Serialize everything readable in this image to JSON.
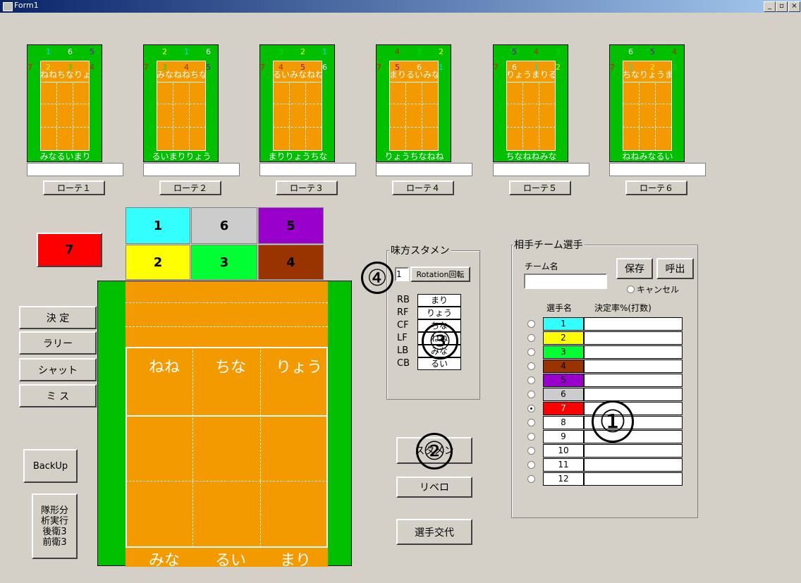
{
  "window": {
    "title": "Form1",
    "min": "_",
    "restore": "▫",
    "close": "×"
  },
  "mini_courts": [
    {
      "top_nums": [
        "1",
        "6",
        "5"
      ],
      "top_colors": [
        "#00e0e0",
        "#ffffff",
        "#8000c0"
      ],
      "left_num": "7",
      "row_nums": [
        "2",
        "3",
        "4"
      ],
      "row_colors": [
        "#ffff00",
        "#00e000",
        "#a03000"
      ],
      "names": "ねねちなりょう",
      "bottom": "みなるいまり",
      "button": "ローテ１"
    },
    {
      "top_nums": [
        "2",
        "1",
        "6"
      ],
      "top_colors": [
        "#ffff00",
        "#00e0e0",
        "#ffffff"
      ],
      "left_num": "7",
      "row_nums": [
        "3",
        "4",
        "5"
      ],
      "row_colors": [
        "#00e000",
        "#a03000",
        "#8000c0"
      ],
      "names": "みなねねちな",
      "bottom": "るいまりりょう",
      "button": "ローテ２"
    },
    {
      "top_nums": [
        "3",
        "2",
        "1"
      ],
      "top_colors": [
        "#00e000",
        "#ffff00",
        "#00e0e0"
      ],
      "left_num": "7",
      "row_nums": [
        "4",
        "5",
        "6"
      ],
      "row_colors": [
        "#a03000",
        "#8000c0",
        "#ffffff"
      ],
      "names": "るいみなねね",
      "bottom": "まりりょうちな",
      "button": "ローテ３"
    },
    {
      "top_nums": [
        "4",
        "3",
        "2"
      ],
      "top_colors": [
        "#a03000",
        "#00e000",
        "#ffff00"
      ],
      "left_num": "7",
      "row_nums": [
        "5",
        "6",
        "1"
      ],
      "row_colors": [
        "#8000c0",
        "#ffffff",
        "#00e0e0"
      ],
      "names": "まりるいみな",
      "bottom": "りょうちなねね",
      "button": "ローテ４"
    },
    {
      "top_nums": [
        "5",
        "4",
        "3"
      ],
      "top_colors": [
        "#8000c0",
        "#a03000",
        "#00e000"
      ],
      "left_num": "7",
      "row_nums": [
        "6",
        "1",
        "2"
      ],
      "row_colors": [
        "#ffffff",
        "#00e0e0",
        "#ffff00"
      ],
      "names": "りょうまりるい",
      "bottom": "ちなねねみな",
      "button": "ローテ５"
    },
    {
      "top_nums": [
        "6",
        "5",
        "4"
      ],
      "top_colors": [
        "#ffffff",
        "#8000c0",
        "#a03000"
      ],
      "left_num": "7",
      "row_nums": [
        "1",
        "2",
        "3"
      ],
      "row_colors": [
        "#00e0e0",
        "#ffff00",
        "#00e000"
      ],
      "names": "ちなりょうまり",
      "bottom": "ねねみなるい",
      "button": "ローテ６"
    }
  ],
  "big_court": {
    "top_nums": [
      "1",
      "6",
      "5"
    ],
    "row_nums": [
      "2",
      "3",
      "4"
    ],
    "libero": "7",
    "front_names": [
      "ねね",
      "ちな",
      "りょう"
    ],
    "back_names": [
      "みな",
      "るい",
      "まり"
    ],
    "colors": {
      "n1": "#33ffff",
      "n6": "#cccccc",
      "n5": "#9900cc",
      "n2": "#ffff00",
      "n3": "#00ff33",
      "n4": "#993300",
      "n7": "#ff0000"
    }
  },
  "left_buttons": {
    "kettei": "決 定",
    "rally": "ラリー",
    "shut": "シャット",
    "miss": "ミ ス",
    "backup": "BackUp",
    "analyze": [
      "隊形分",
      "析実行",
      "後衛3",
      "前衛3"
    ]
  },
  "starters": {
    "label": "味方スタメン",
    "rot_value": "1",
    "rot_button": "Rotation回転",
    "rows": [
      {
        "pos": "RB",
        "name": "まり"
      },
      {
        "pos": "RF",
        "name": "りょう"
      },
      {
        "pos": "CF",
        "name": "ちな"
      },
      {
        "pos": "LF",
        "name": "ねね"
      },
      {
        "pos": "LB",
        "name": "みな"
      },
      {
        "pos": "CB",
        "name": "るい"
      }
    ]
  },
  "center_buttons": {
    "starter": "スタメン",
    "libero": "リベロ",
    "sub": "選手交代"
  },
  "opponents": {
    "label": "相手チーム選手",
    "team_label": "チーム名",
    "save": "保存",
    "load": "呼出",
    "cancel": "キャンセル",
    "col_name": "選手名",
    "col_rate": "決定率%(打数)",
    "selected": "7",
    "players": [
      {
        "num": "1",
        "color": "#33ffff",
        "fg": "#000000"
      },
      {
        "num": "2",
        "color": "#ffff00",
        "fg": "#000000"
      },
      {
        "num": "3",
        "color": "#00ff33",
        "fg": "#000000"
      },
      {
        "num": "4",
        "color": "#993300",
        "fg": "#000000"
      },
      {
        "num": "5",
        "color": "#9900cc",
        "fg": "#000000"
      },
      {
        "num": "6",
        "color": "#cccccc",
        "fg": "#000000"
      },
      {
        "num": "7",
        "color": "#ff0000",
        "fg": "#ffffff"
      },
      {
        "num": "8",
        "color": "#ffffff",
        "fg": "#000000"
      },
      {
        "num": "9",
        "color": "#ffffff",
        "fg": "#000000"
      },
      {
        "num": "10",
        "color": "#ffffff",
        "fg": "#000000"
      },
      {
        "num": "11",
        "color": "#ffffff",
        "fg": "#000000"
      },
      {
        "num": "12",
        "color": "#ffffff",
        "fg": "#000000"
      }
    ]
  },
  "annotations": {
    "a1": "①",
    "a2": "②",
    "a3": "③",
    "a4": "④"
  }
}
